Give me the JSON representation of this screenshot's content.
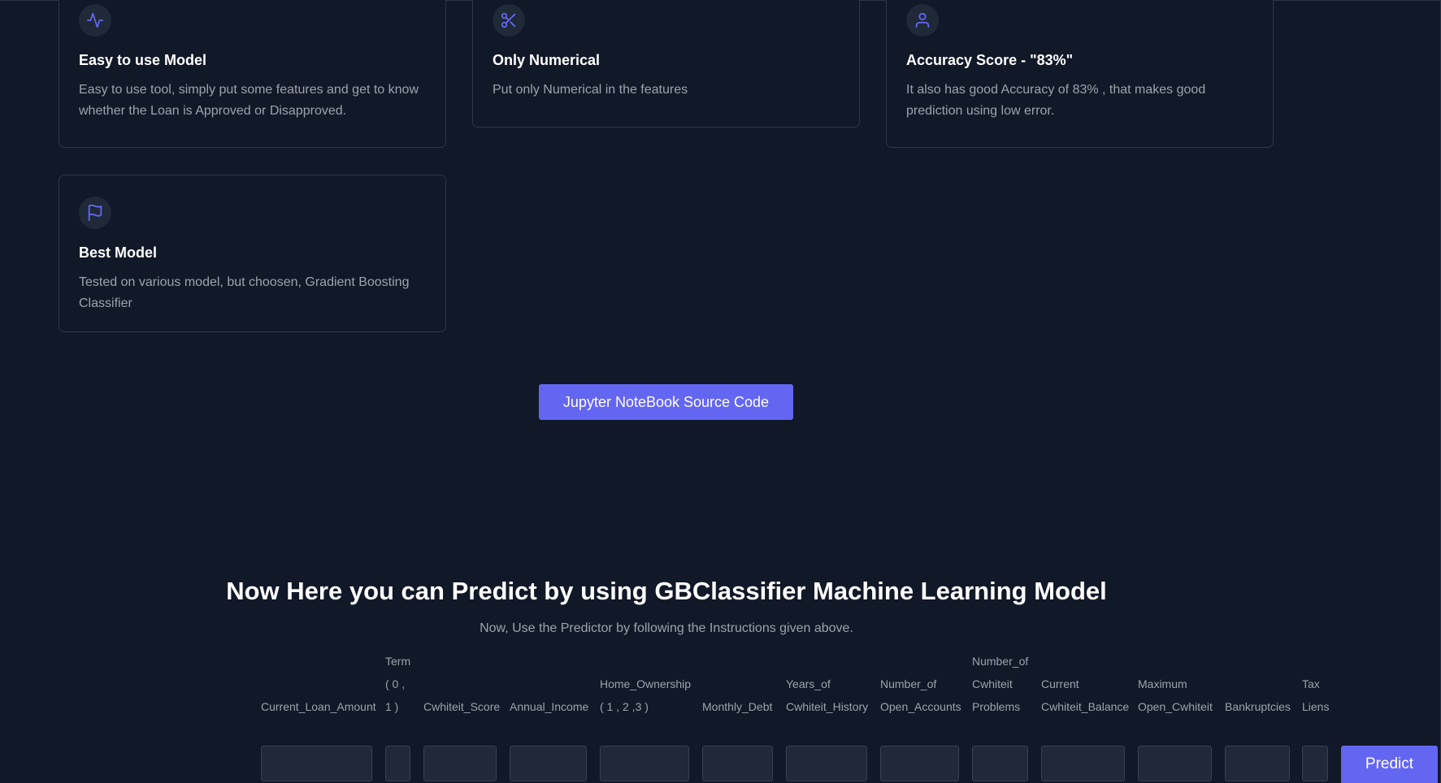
{
  "features": [
    {
      "icon": "activity-icon",
      "title": "Easy to use Model",
      "description": "Easy to use tool, simply put some features and get to know whether the Loan is Approved or Disapproved."
    },
    {
      "icon": "scissors-icon",
      "title": "Only Numerical",
      "description": "Put only Numerical in the features"
    },
    {
      "icon": "user-icon",
      "title": "Accuracy Score - \"83%\"",
      "description": "It also has good Accuracy of 83% , that makes good prediction using low error."
    },
    {
      "icon": "flag-icon",
      "title": "Best Model",
      "description": "Tested on various model, but choosen, Gradient Boosting Classifier"
    }
  ],
  "source_button_label": "Jupyter NoteBook Source Code",
  "predictor": {
    "title": "Now Here you can Predict by using GBClassifier Machine Learning Model",
    "subtitle": "Now, Use the Predictor by following the Instructions given above.",
    "fields": [
      {
        "label": "Current_Loan_Amount",
        "value": ""
      },
      {
        "label": "Term\n( 0 ,\n1 )",
        "value": ""
      },
      {
        "label": "Cwhiteit_Score",
        "value": ""
      },
      {
        "label": "Annual_Income",
        "value": ""
      },
      {
        "label": "Home_Ownership\n( 1 , 2 ,3 )",
        "value": ""
      },
      {
        "label": "Monthly_Debt",
        "value": ""
      },
      {
        "label": "Years_of\nCwhiteit_History",
        "value": ""
      },
      {
        "label": "Number_of\nOpen_Accounts",
        "value": ""
      },
      {
        "label": "Number_of\nCwhiteit\nProblems",
        "value": ""
      },
      {
        "label": "Current\nCwhiteit_Balance",
        "value": ""
      },
      {
        "label": "Maximum\nOpen_Cwhiteit",
        "value": ""
      },
      {
        "label": "Bankruptcies",
        "value": ""
      },
      {
        "label": "Tax\nLiens",
        "value": ""
      }
    ],
    "predict_label": "Predict"
  }
}
